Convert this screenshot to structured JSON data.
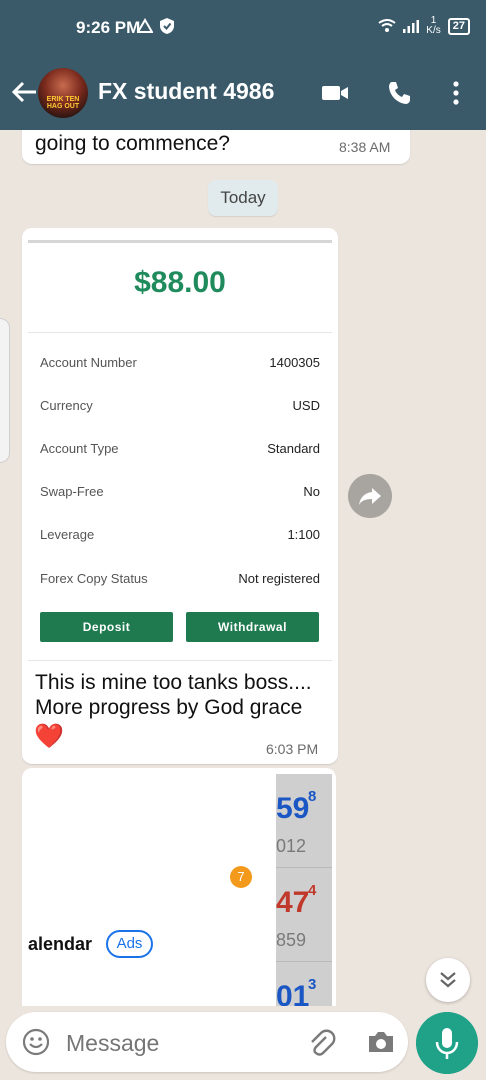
{
  "status_bar": {
    "time": "9:26 PM",
    "net_speed_value": "1",
    "net_speed_unit": "K/s",
    "battery": "27"
  },
  "header": {
    "contact_name": "FX student 4986",
    "avatar_text": "ERIK TEN HAG OUT"
  },
  "messages": {
    "prev_text": "going to commence?",
    "prev_time": "8:38 AM",
    "day_chip": "Today",
    "card": {
      "amount": "$88.00",
      "rows": [
        {
          "label": "Account Number",
          "value": "1400305"
        },
        {
          "label": "Currency",
          "value": "USD"
        },
        {
          "label": "Account Type",
          "value": "Standard"
        },
        {
          "label": "Swap-Free",
          "value": "No"
        },
        {
          "label": "Leverage",
          "value": "1:100"
        },
        {
          "label": "Forex Copy Status",
          "value": "Not registered"
        }
      ],
      "deposit_label": "Deposit",
      "withdrawal_label": "Withdrawal"
    },
    "caption_line1": "This is mine too tanks boss....",
    "caption_line2": "More progress by God grace",
    "caption_emoji": "❤️",
    "caption_time": "6:03 PM"
  },
  "ad": {
    "cells": [
      {
        "big": "59",
        "sup": "8",
        "small": "012",
        "color": "#1a56c4"
      },
      {
        "big": "47",
        "sup": "4",
        "small": "859",
        "color": "#c0392b"
      },
      {
        "big": "01",
        "sup": "3",
        "small": "",
        "color": "#1a56c4"
      }
    ],
    "badge": "7",
    "text": "alendar",
    "pill": "Ads"
  },
  "input": {
    "placeholder": "Message"
  },
  "colors": {
    "header": "#3a5a6a",
    "accent": "#1fa287",
    "card_green": "#1f7a4f"
  }
}
